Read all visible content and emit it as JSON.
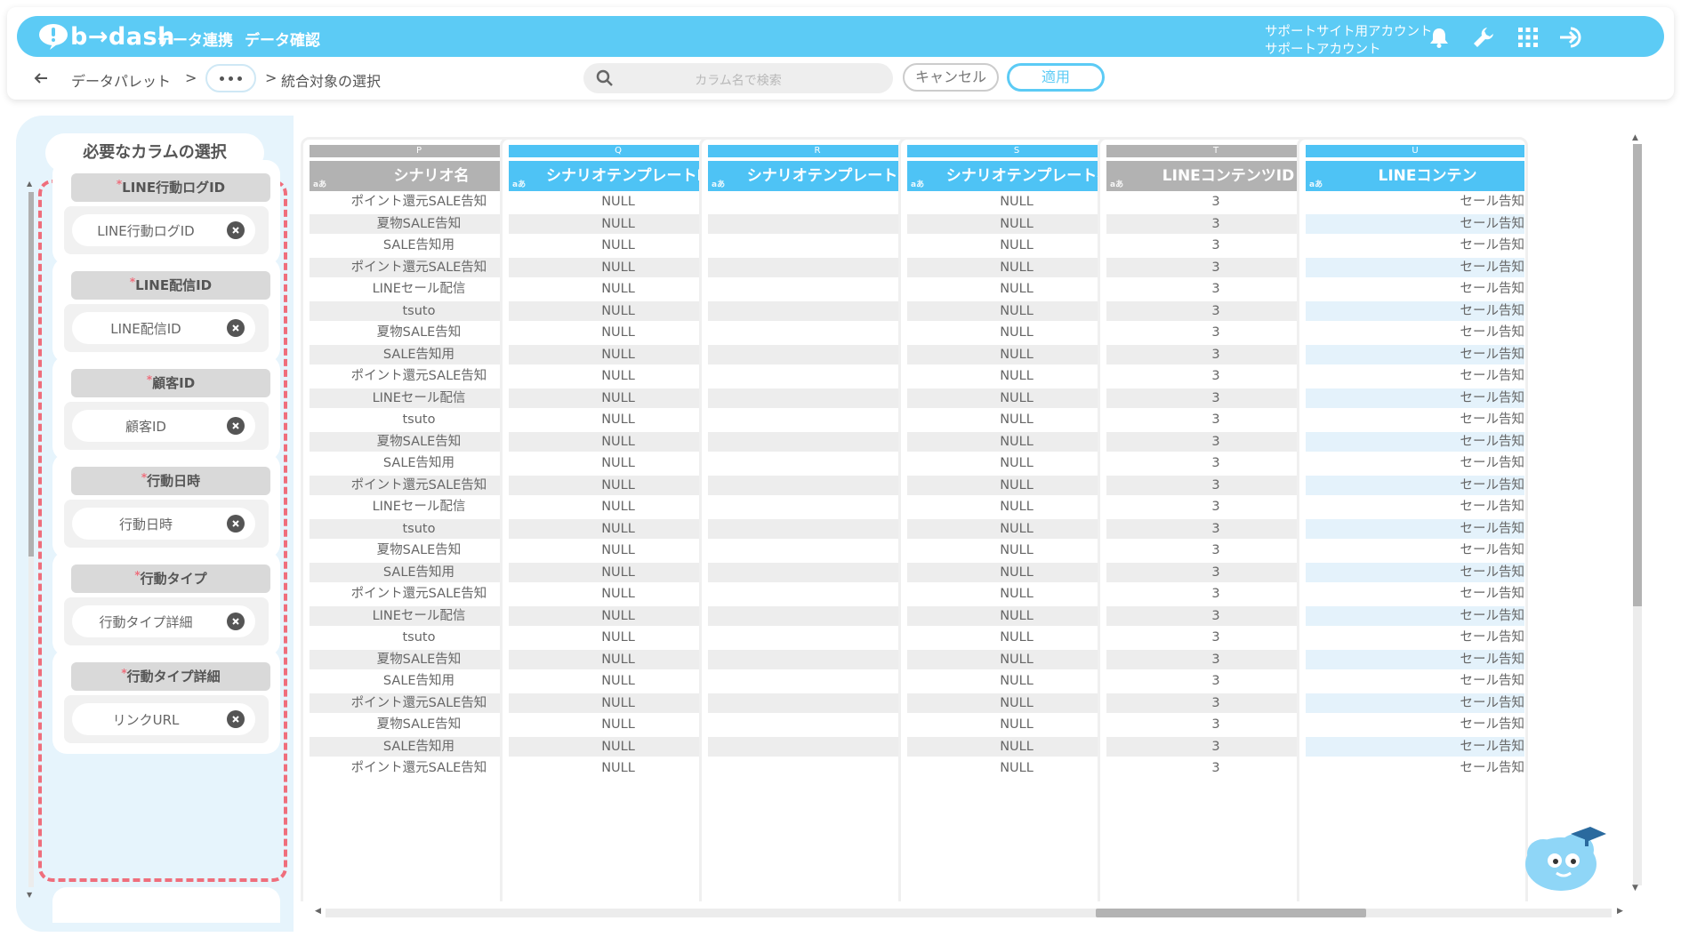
{
  "header": {
    "logo": "b→dash",
    "nav": [
      "データ連携",
      "データ確認"
    ],
    "account_line1": "サポートサイト用アカウント",
    "account_line2": "サポートアカウント",
    "icons": [
      "bell-icon",
      "wrench-icon",
      "grid-icon",
      "logout-icon"
    ]
  },
  "breadcrumb": {
    "first": "データパレット",
    "sep": ">",
    "current": "統合対象の選択"
  },
  "search": {
    "placeholder": "カラム名で検索"
  },
  "buttons": {
    "cancel": "キャンセル",
    "apply": "適用"
  },
  "left_panel": {
    "title": "必要なカラムの選択",
    "required_mark": "*",
    "mappings": [
      {
        "label": "LINE行動ログID",
        "value": "LINE行動ログID"
      },
      {
        "label": "LINE配信ID",
        "value": "LINE配信ID"
      },
      {
        "label": "顧客ID",
        "value": "顧客ID"
      },
      {
        "label": "行動日時",
        "value": "行動日時"
      },
      {
        "label": "行動タイプ",
        "value": "行動タイプ詳細"
      },
      {
        "label": "行動タイプ詳細",
        "value": "リンクURL"
      }
    ]
  },
  "table": {
    "type_tag": "aあ",
    "columns": [
      {
        "letter": "P",
        "header": "シナリオ名",
        "style": "gray"
      },
      {
        "letter": "Q",
        "header": "シナリオテンプレートID",
        "style": "blue"
      },
      {
        "letter": "R",
        "header": "シナリオテンプレート…",
        "style": "blue"
      },
      {
        "letter": "S",
        "header": "シナリオテンプレート名",
        "style": "blue"
      },
      {
        "letter": "T",
        "header": "LINEコンテンツID",
        "style": "gray"
      },
      {
        "letter": "U",
        "header": "LINEコンテン",
        "style": "blue"
      }
    ],
    "col_p": [
      "ポイント還元SALE告知",
      "夏物SALE告知",
      "SALE告知用",
      "ポイント還元SALE告知",
      "LINEセール配信",
      "tsuto",
      "夏物SALE告知",
      "SALE告知用",
      "ポイント還元SALE告知",
      "LINEセール配信",
      "tsuto",
      "夏物SALE告知",
      "SALE告知用",
      "ポイント還元SALE告知",
      "LINEセール配信",
      "tsuto",
      "夏物SALE告知",
      "SALE告知用",
      "ポイント還元SALE告知",
      "LINEセール配信",
      "tsuto",
      "夏物SALE告知",
      "SALE告知用",
      "ポイント還元SALE告知",
      "夏物SALE告知",
      "SALE告知用",
      "ポイント還元SALE告知"
    ],
    "col_q": "NULL",
    "col_r": "",
    "col_s": "NULL",
    "col_t": "3",
    "col_u": "セール告知"
  }
}
